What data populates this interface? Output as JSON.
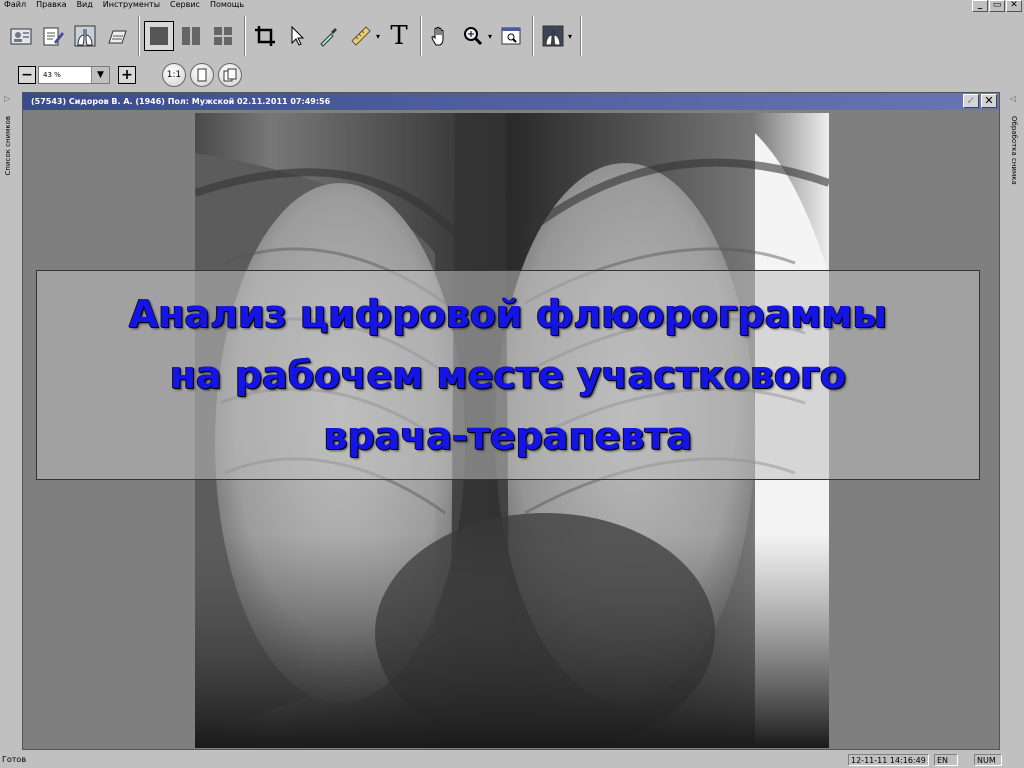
{
  "menu": [
    "Файл",
    "Правка",
    "Вид",
    "Инструменты",
    "Сервис",
    "Помощь"
  ],
  "window_controls": {
    "minimize": "_",
    "restore": "▭",
    "close": "✕"
  },
  "toolbar_icons": [
    "patient-card-icon",
    "edit-icon",
    "lungs-icon",
    "film-icon",
    "layout-single-icon",
    "layout-two-icon",
    "layout-four-icon",
    "crop-icon",
    "pointer-icon",
    "pipette-icon",
    "ruler-icon",
    "text-icon",
    "hand-icon",
    "zoom-icon",
    "zoom-window-icon",
    "lungs-invert-icon"
  ],
  "text_tool_glyph": "T",
  "zoom": {
    "minus": "−",
    "value": "43 %",
    "plus": "+",
    "one_to_one": "1:1"
  },
  "left_panel_label": "Список снимков",
  "right_panel_label": "Обработка снимка",
  "image_window": {
    "title": "(57543)  Сидоров В. А. (1946) Пол: Мужской   02.11.2011 07:49:56",
    "accept": "✓",
    "close": "✕"
  },
  "overlay_title": {
    "line1": "Анализ цифровой флюорограммы",
    "line2": "на рабочем месте участкового",
    "line3": "врача-терапевта"
  },
  "status": {
    "ready": "Готов",
    "datetime": "12-11-11 14:16:49",
    "lang": "EN",
    "num": "NUM"
  },
  "colors": {
    "title_text": "#1414e6",
    "titlebar": "#3a4a8c"
  }
}
